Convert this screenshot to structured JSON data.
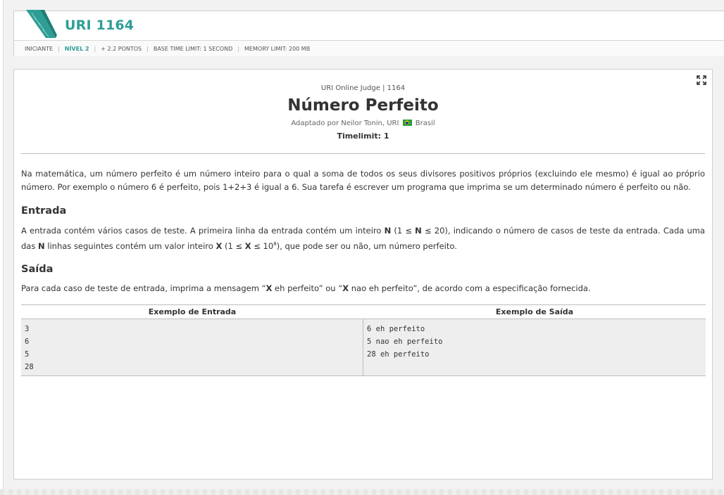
{
  "header": {
    "title": "URI 1164",
    "meta": {
      "category": "INICIANTE",
      "level": "NÍVEL 2",
      "points": "+ 2.2 PONTOS",
      "base_time_limit": "BASE TIME LIMIT: 1 SECOND",
      "memory_limit": "MEMORY LIMIT: 200 MB"
    }
  },
  "problem": {
    "judge_line": "URI Online Judge | 1164",
    "title": "Número Perfeito",
    "author_prefix": "Adaptado por Neilor Tonin, URI",
    "country": "Brasil",
    "timelimit": "Timelimit: 1",
    "description": "Na matemática, um número perfeito é um número inteiro para o qual a soma de todos os seus divisores positivos próprios (excluindo ele mesmo) é igual ao próprio número. Por exemplo o número 6 é perfeito, pois 1+2+3 é igual a 6. Sua tarefa é escrever um programa que imprima se um determinado número é perfeito ou não.",
    "input_heading": "Entrada",
    "input_text": {
      "p1": "A entrada contém vários casos de teste. A primeira linha da entrada contém um inteiro ",
      "b1": "N",
      "p2": " (1 ≤ ",
      "b2": "N",
      "p3": " ≤ 20), indicando o número de casos de teste da entrada. Cada uma das ",
      "b3": "N",
      "p4": " linhas seguintes contém um valor inteiro ",
      "b4": "X",
      "p5": " (1 ≤ ",
      "b5": "X",
      "p6": " ≤ 10",
      "sup": "8",
      "p7": "), que pode ser ou não, um número perfeito."
    },
    "output_heading": "Saída",
    "output_text": {
      "p1": "Para cada caso de teste de entrada, imprima a mensagem “",
      "b1": "X",
      "p2": " eh perfeito” ou “",
      "b2": "X",
      "p3": " nao eh perfeito”, de acordo com a especificação fornecida."
    }
  },
  "samples": {
    "input_header": "Exemplo de Entrada",
    "output_header": "Exemplo de Saída",
    "input_lines": [
      "3",
      "6",
      "5",
      "28"
    ],
    "output_lines": [
      "6 eh perfeito",
      "5 nao eh perfeito",
      "28 eh perfeito"
    ]
  },
  "colors": {
    "accent": "#2e9e95",
    "sample_bg": "#eeeeee"
  },
  "icons": {
    "logo": "uri-logo-icon",
    "expand": "expand-icon",
    "flag": "brazil-flag-icon"
  }
}
